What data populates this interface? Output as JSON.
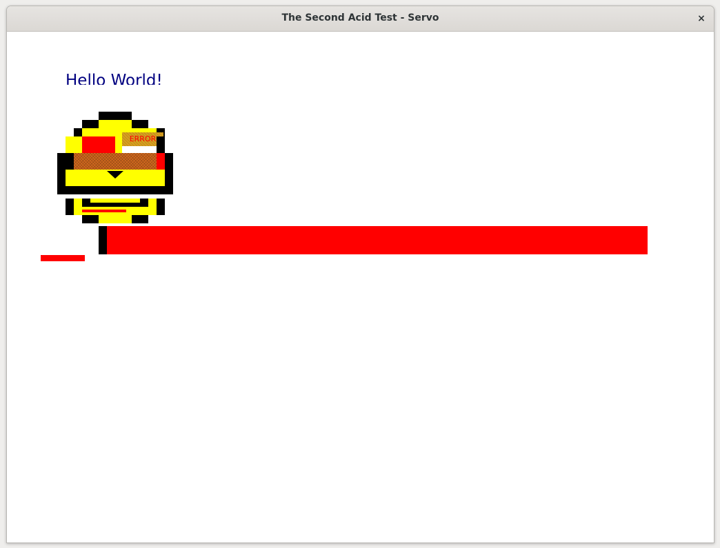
{
  "window": {
    "title": "The Second Acid Test - Servo",
    "close_glyph": "×"
  },
  "page": {
    "greeting": "Hello World!",
    "smiley_error_text": "ERROR"
  },
  "colors": {
    "greeting": "#000080",
    "face": "#ffff00",
    "outline": "#000000",
    "error_red": "#ff0000"
  },
  "icons": {
    "close": "close-icon",
    "smiley": "acid2-smiley-face"
  }
}
